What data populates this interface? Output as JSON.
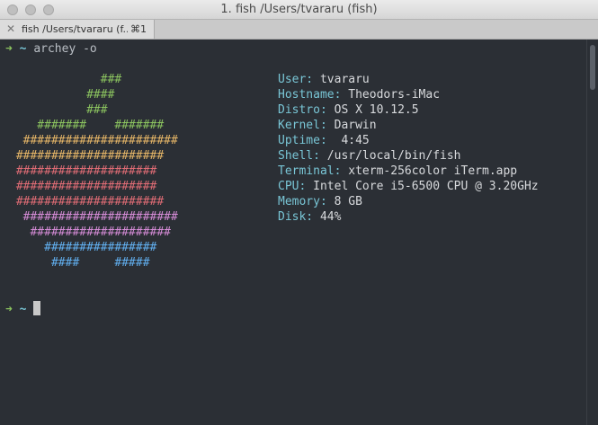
{
  "window": {
    "title": "1. fish  /Users/tvararu (fish)"
  },
  "tab": {
    "close": "✕",
    "label": "fish  /Users/tvararu (f...",
    "shortcut": "⌘1"
  },
  "prompt": {
    "arrow": "➜",
    "tilde": "~",
    "command": "archey -o"
  },
  "logo": [
    {
      "text": "             ###",
      "color": "#8bc35f"
    },
    {
      "text": "           ####",
      "color": "#8bc35f"
    },
    {
      "text": "           ###",
      "color": "#8bc35f"
    },
    {
      "text": "    #######    #######",
      "color": "#8bc35f"
    },
    {
      "text": "  ######################",
      "color": "#e5b567"
    },
    {
      "text": " #####################",
      "color": "#e5b567"
    },
    {
      "text": " ####################",
      "color": "#e06c75"
    },
    {
      "text": " ####################",
      "color": "#e06c75"
    },
    {
      "text": " #####################",
      "color": "#e06c75"
    },
    {
      "text": "  ######################",
      "color": "#d58bd6"
    },
    {
      "text": "   ####################",
      "color": "#d58bd6"
    },
    {
      "text": "     ################",
      "color": "#61afef"
    },
    {
      "text": "      ####     #####",
      "color": "#61afef"
    }
  ],
  "info": [
    {
      "key": "User:",
      "value": " tvararu"
    },
    {
      "key": "Hostname:",
      "value": " Theodors-iMac"
    },
    {
      "key": "Distro:",
      "value": " OS X 10.12.5"
    },
    {
      "key": "Kernel:",
      "value": " Darwin"
    },
    {
      "key": "Uptime:",
      "value": "  4:45"
    },
    {
      "key": "Shell:",
      "value": " /usr/local/bin/fish"
    },
    {
      "key": "Terminal:",
      "value": " xterm-256color iTerm.app"
    },
    {
      "key": "CPU:",
      "value": " Intel Core i5-6500 CPU @ 3.20GHz"
    },
    {
      "key": "Memory:",
      "value": " 8 GB"
    },
    {
      "key": "Disk:",
      "value": " 44%"
    }
  ],
  "prompt2": {
    "arrow": "➜",
    "tilde": "~"
  }
}
